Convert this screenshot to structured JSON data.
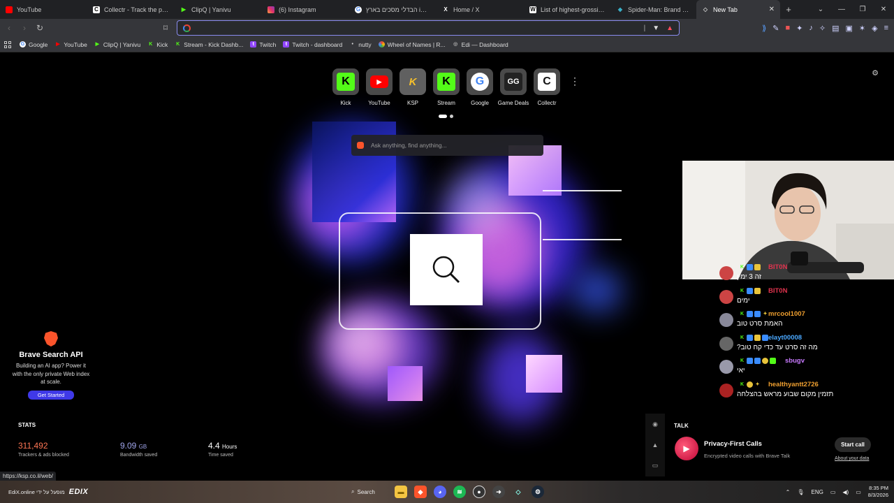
{
  "tabs": [
    {
      "title": "YouTube",
      "fav": "yt",
      "color": "#ff0000"
    },
    {
      "title": "Collectr - Track the prices",
      "fav": "C",
      "color": "#ffffff"
    },
    {
      "title": "ClipQ | Yanivu",
      "fav": "▶",
      "color": "#53fc18"
    },
    {
      "title": "(6) Instagram",
      "fav": "ig",
      "color": "#e1306c"
    },
    {
      "title": "הבדלי מסכים בארץ imax",
      "fav": "G",
      "color": "#4285f4"
    },
    {
      "title": "Home / X",
      "fav": "X",
      "color": "#ffffff"
    },
    {
      "title": "List of highest-grossing F",
      "fav": "W",
      "color": "#ffffff"
    },
    {
      "title": "Spider-Man: Brand New D",
      "fav": "◆",
      "color": "#3ab0c8"
    },
    {
      "title": "New Tab",
      "fav": "◇",
      "color": "#cccccc"
    }
  ],
  "omnibox": {
    "value": "",
    "placeholder": ""
  },
  "bookmarks": [
    {
      "label": "Google",
      "fav": "G",
      "color": "#4285f4"
    },
    {
      "label": "YouTube",
      "fav": "▶",
      "color": "#ff0000"
    },
    {
      "label": "ClipQ | Yanivu",
      "fav": "▶",
      "color": "#53fc18"
    },
    {
      "label": "Kick",
      "fav": "K",
      "color": "#53fc18"
    },
    {
      "label": "Stream - Kick Dashb...",
      "fav": "K",
      "color": "#53fc18"
    },
    {
      "label": "Twitch",
      "fav": "t",
      "color": "#9146ff"
    },
    {
      "label": "Twitch - dashboard",
      "fav": "t",
      "color": "#9146ff"
    },
    {
      "label": "nutty",
      "fav": "•",
      "color": "#dddddd"
    },
    {
      "label": "Wheel of Names | R...",
      "fav": "◉",
      "color": "#f4b400"
    },
    {
      "label": "Edi — Dashboard",
      "fav": "◎",
      "color": "#aaaaaa"
    }
  ],
  "top_sites": [
    {
      "label": "Kick",
      "glyph": "K",
      "bg": "#53fc18",
      "fg": "#000000"
    },
    {
      "label": "YouTube",
      "glyph": "▶",
      "bg": "#ff0000",
      "fg": "#ffffff"
    },
    {
      "label": "KSP",
      "glyph": "K",
      "bg": "#5a5a5a",
      "fg": "#f6c02c"
    },
    {
      "label": "Stream",
      "glyph": "K",
      "bg": "#53fc18",
      "fg": "#000000"
    },
    {
      "label": "Google",
      "glyph": "G",
      "bg": "#ffffff",
      "fg": "#4285f4"
    },
    {
      "label": "Game Deals",
      "glyph": "GG",
      "bg": "#2a2a2a",
      "fg": "#ffffff"
    },
    {
      "label": "Collectr",
      "glyph": "C",
      "bg": "#ffffff",
      "fg": "#111111"
    }
  ],
  "ask_box": {
    "placeholder": "Ask anything, find anything..."
  },
  "promo": {
    "title": "Brave Search API",
    "body": "Building an AI app? Power it with the only private Web index at scale.",
    "button": "Get Started"
  },
  "stats": {
    "title": "STATS",
    "trackers": {
      "value": "311,492",
      "label": "Trackers & ads blocked",
      "color": "#ff7654"
    },
    "bandwidth": {
      "value": "9.09",
      "unit": "GB",
      "label": "Bandwidth saved",
      "color": "#a0a5eb"
    },
    "time": {
      "value": "4.4",
      "unit": "Hours",
      "label": "Time saved",
      "color": "#ffffff"
    }
  },
  "chat": [
    {
      "user": "BIT0N",
      "color": "#e0334e",
      "text": "זה 3 ימין",
      "avatar": "#c44"
    },
    {
      "user": "BIT0N",
      "color": "#e0334e",
      "text": "ימים",
      "avatar": "#c44"
    },
    {
      "user": "mrcool1007",
      "color": "#f0a030",
      "text": "האמת סרט טוב",
      "avatar": "#889"
    },
    {
      "user": "elayt00008",
      "color": "#4aa8ff",
      "text": "מה זה סרט עד כדי קח טוב?",
      "avatar": "#666"
    },
    {
      "user": "sbugv",
      "color": "#c87aff",
      "text": "יאי",
      "avatar": "#99a"
    },
    {
      "user": "healthyantt2726",
      "color": "#f0a030",
      "text": "תזמין מקום שבוע מראש בהצלחה",
      "avatar": "#a22"
    }
  ],
  "talk": {
    "title": "TALK",
    "headline": "Privacy-First Calls",
    "sub": "Encrypted video calls with Brave Talk",
    "button": "Start call",
    "link": "About your data"
  },
  "status_url": "https://ksp.co.il/web/",
  "taskbar": {
    "left_text": "EdiX.online מופעל על ידי",
    "logo": "EDIX",
    "search": "Search",
    "lang": "ENG",
    "time": "8:35 PM",
    "date": "8/3/2026"
  }
}
